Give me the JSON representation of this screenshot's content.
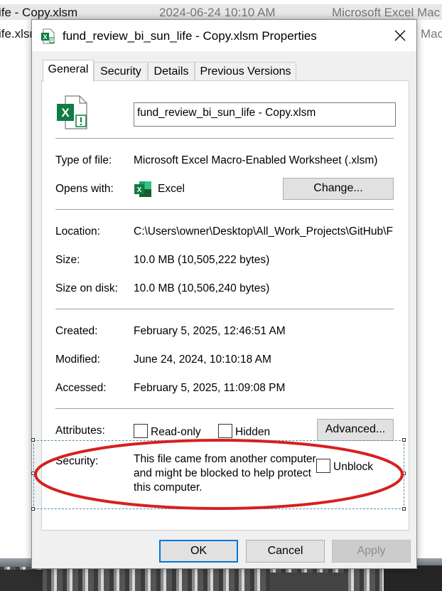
{
  "background": {
    "row1": {
      "name": "ife - Copy.xlsm",
      "date": "2024-06-24 10:10 AM",
      "type": "Microsoft Excel Mac"
    },
    "row2": {
      "name": "ife.xlsm",
      "type": "Mac"
    }
  },
  "dialog": {
    "title": "fund_review_bi_sun_life - Copy.xlsm Properties",
    "tabs": [
      "General",
      "Security",
      "Details",
      "Previous Versions"
    ],
    "filename": "fund_review_bi_sun_life - Copy.xlsm",
    "type_label": "Type of file:",
    "type_value": "Microsoft Excel Macro-Enabled Worksheet (.xlsm)",
    "opens_label": "Opens with:",
    "opens_value": "Excel",
    "change_label": "Change...",
    "location_label": "Location:",
    "location_value": "C:\\Users\\owner\\Desktop\\All_Work_Projects\\GitHub\\F",
    "size_label": "Size:",
    "size_value": "10.0 MB (10,505,222 bytes)",
    "size_disk_label": "Size on disk:",
    "size_disk_value": "10.0 MB (10,506,240 bytes)",
    "created_label": "Created:",
    "created_value": "February 5, 2025, 12:46:51 AM",
    "modified_label": "Modified:",
    "modified_value": "June 24, 2024, 10:10:18 AM",
    "accessed_label": "Accessed:",
    "accessed_value": "February 5, 2025, 11:09:08 PM",
    "attributes_label": "Attributes:",
    "readonly_label": "Read-only",
    "hidden_label": "Hidden",
    "advanced_label": "Advanced...",
    "security_label": "Security:",
    "security_text": "This file came from another computer and might be blocked to help protect this computer.",
    "unblock_label": "Unblock",
    "ok_label": "OK",
    "cancel_label": "Cancel",
    "apply_label": "Apply"
  },
  "colors": {
    "excel_green": "#107c41",
    "annotation_red": "#d62020",
    "accent_blue": "#0078d7"
  }
}
